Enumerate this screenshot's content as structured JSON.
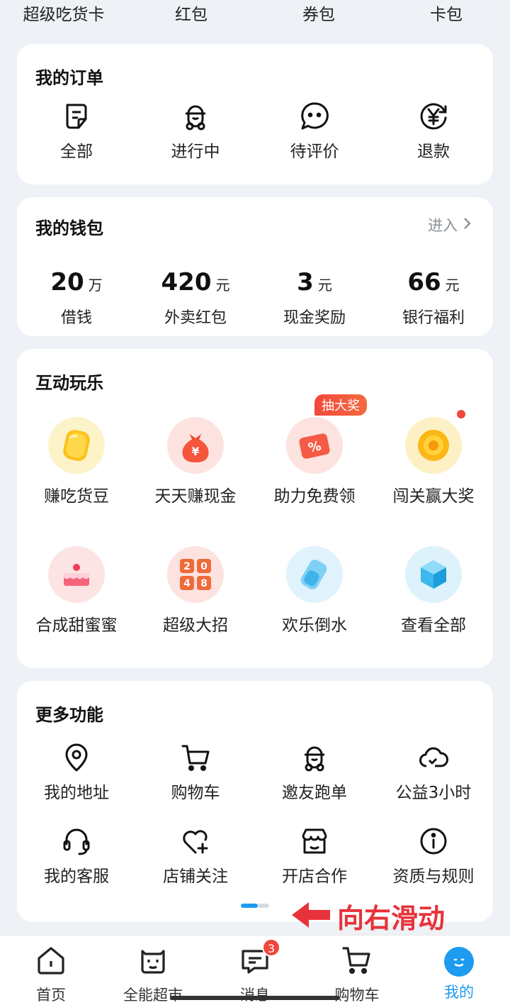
{
  "top_strip": [
    "超级吃货卡",
    "红包",
    "券包",
    "卡包"
  ],
  "orders": {
    "title": "我的订单",
    "items": [
      {
        "label": "全部",
        "icon": "order-list-icon"
      },
      {
        "label": "进行中",
        "icon": "rider-icon"
      },
      {
        "label": "待评价",
        "icon": "comment-icon"
      },
      {
        "label": "退款",
        "icon": "refund-yen-icon"
      }
    ]
  },
  "wallet": {
    "title": "我的钱包",
    "enter": "进入",
    "items": [
      {
        "amount": "20",
        "unit": "万",
        "label": "借钱"
      },
      {
        "amount": "420",
        "unit": "元",
        "label": "外卖红包"
      },
      {
        "amount": "3",
        "unit": "元",
        "label": "现金奖励"
      },
      {
        "amount": "66",
        "unit": "元",
        "label": "银行福利"
      }
    ]
  },
  "games": {
    "title": "互动玩乐",
    "tag": "抽大奖",
    "items": [
      {
        "label": "赚吃货豆",
        "icon": "bean-icon"
      },
      {
        "label": "天天赚现金",
        "icon": "money-bag-icon"
      },
      {
        "label": "助力免费领",
        "icon": "coupon-percent-icon"
      },
      {
        "label": "闯关赢大奖",
        "icon": "coin-target-icon"
      },
      {
        "label": "合成甜蜜蜜",
        "icon": "cake-icon"
      },
      {
        "label": "超级大招",
        "icon": "2048-icon",
        "digits": [
          "2",
          "0",
          "4",
          "8"
        ]
      },
      {
        "label": "欢乐倒水",
        "icon": "water-cup-icon"
      },
      {
        "label": "查看全部",
        "icon": "cube-icon"
      }
    ]
  },
  "more": {
    "title": "更多功能",
    "items": [
      {
        "label": "我的地址",
        "icon": "location-icon"
      },
      {
        "label": "购物车",
        "icon": "cart-icon"
      },
      {
        "label": "邀友跑单",
        "icon": "rider-icon"
      },
      {
        "label": "公益3小时",
        "icon": "cloud-heart-icon"
      },
      {
        "label": "我的客服",
        "icon": "headset-icon"
      },
      {
        "label": "店铺关注",
        "icon": "heart-plus-icon"
      },
      {
        "label": "开店合作",
        "icon": "store-icon"
      },
      {
        "label": "资质与规则",
        "icon": "info-icon"
      }
    ]
  },
  "swipe_hint": "向右滑动",
  "bottom_nav": {
    "items": [
      {
        "label": "首页",
        "icon": "home-icon"
      },
      {
        "label": "全能超市",
        "icon": "supermarket-icon"
      },
      {
        "label": "消息",
        "icon": "message-icon",
        "badge": "3"
      },
      {
        "label": "购物车",
        "icon": "cart-icon"
      },
      {
        "label": "我的",
        "icon": "profile-icon",
        "active": true
      }
    ]
  },
  "colors": {
    "accent": "#1d9bf0",
    "red": "#f0463c",
    "background": "#eef1f5"
  }
}
